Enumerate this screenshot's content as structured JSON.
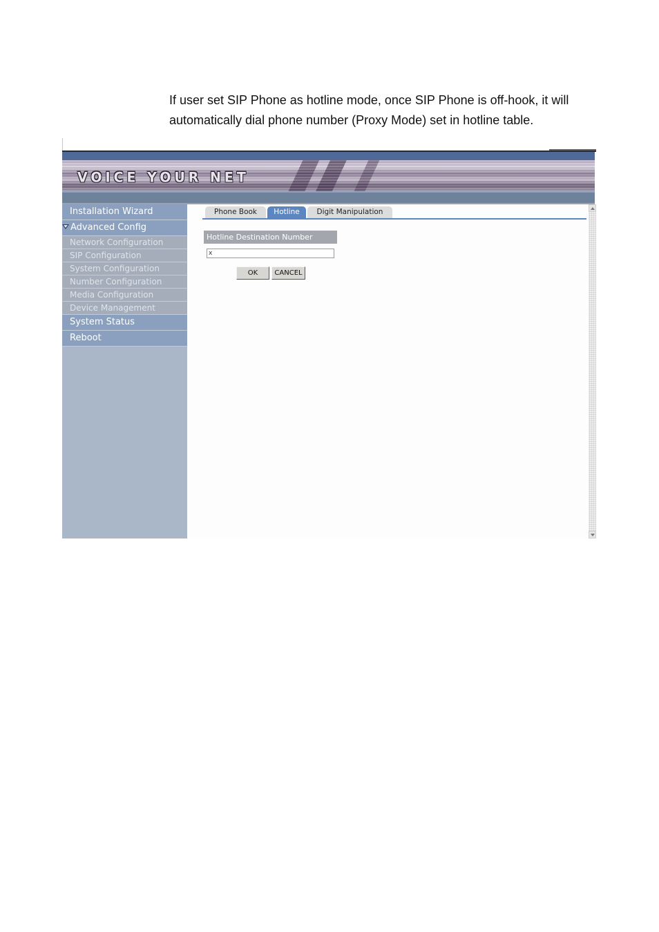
{
  "document": {
    "paragraph_line1": "If user set SIP Phone as hotline mode, once SIP Phone is off-hook, it will",
    "paragraph_line2": "automatically dial phone number (Proxy Mode) set in hotline table."
  },
  "banner": {
    "title": "VOICE YOUR NET"
  },
  "sidebar": {
    "items": [
      {
        "label": "Installation Wizard",
        "type": "main"
      },
      {
        "label": "Advanced Config",
        "type": "main",
        "expanded": true,
        "icon": "triangle-down-icon"
      },
      {
        "label": "Network Configuration",
        "type": "sub"
      },
      {
        "label": "SIP Configuration",
        "type": "sub"
      },
      {
        "label": "System Configuration",
        "type": "sub"
      },
      {
        "label": "Number Configuration",
        "type": "sub"
      },
      {
        "label": "Media Configuration",
        "type": "sub"
      },
      {
        "label": "Device Management",
        "type": "sub"
      },
      {
        "label": "System Status",
        "type": "main"
      },
      {
        "label": "Reboot",
        "type": "main"
      }
    ]
  },
  "tabs": [
    {
      "label": "Phone Book",
      "active": false
    },
    {
      "label": "Hotline",
      "active": true
    },
    {
      "label": "Digit Manipulation",
      "active": false
    }
  ],
  "form": {
    "section_label": "Hotline Destination Number",
    "hotline_value": "x",
    "ok_label": "OK",
    "cancel_label": "CANCEL"
  },
  "colors": {
    "accent": "#5c86c0",
    "sidebar_main": "#8aa0be",
    "sidebar_sub": "#a4adb9",
    "sidebar_bg": "#aab7c9",
    "header_blue": "#4f6a98"
  }
}
